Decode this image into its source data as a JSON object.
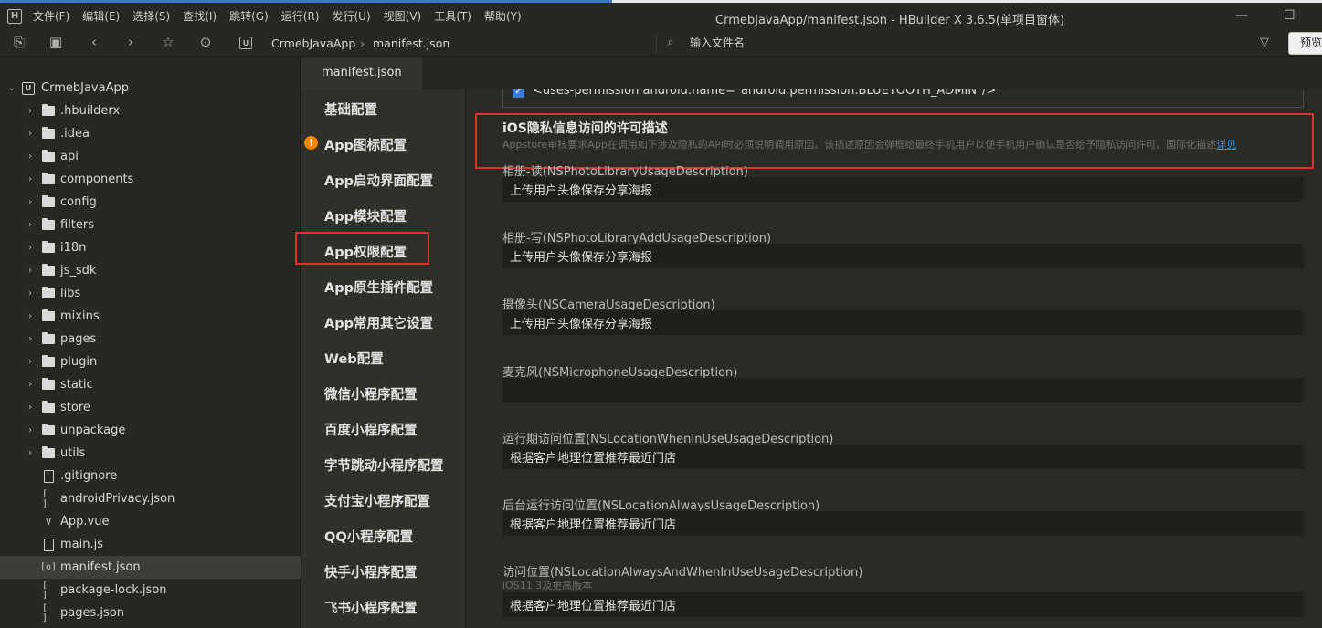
{
  "menu": {
    "logo": "H",
    "items": [
      "文件(F)",
      "编辑(E)",
      "选择(S)",
      "查找(I)",
      "跳转(G)",
      "运行(R)",
      "发行(U)",
      "视图(V)",
      "工具(T)",
      "帮助(Y)"
    ],
    "window_title": "CrmebJavaApp/manifest.json - HBuilder X 3.6.5(单项目窗体)"
  },
  "toolbar": {
    "breadcrumb_icon": "U",
    "breadcrumb": [
      "CrmebJavaApp",
      "manifest.json"
    ],
    "search_placeholder": "输入文件名",
    "preview_label": "预览"
  },
  "sidebar": {
    "root": "CrmebJavaApp",
    "root_icon": "U",
    "items": [
      {
        "label": ".hbuilderx",
        "type": "folder"
      },
      {
        "label": ".idea",
        "type": "folder"
      },
      {
        "label": "api",
        "type": "folder"
      },
      {
        "label": "components",
        "type": "folder"
      },
      {
        "label": "config",
        "type": "folder"
      },
      {
        "label": "filters",
        "type": "folder"
      },
      {
        "label": "i18n",
        "type": "folder"
      },
      {
        "label": "js_sdk",
        "type": "folder"
      },
      {
        "label": "libs",
        "type": "folder"
      },
      {
        "label": "mixins",
        "type": "folder"
      },
      {
        "label": "pages",
        "type": "folder"
      },
      {
        "label": "plugin",
        "type": "folder"
      },
      {
        "label": "static",
        "type": "folder"
      },
      {
        "label": "store",
        "type": "folder"
      },
      {
        "label": "unpackage",
        "type": "folder"
      },
      {
        "label": "utils",
        "type": "folder"
      },
      {
        "label": ".gitignore",
        "type": "file",
        "glyph": ""
      },
      {
        "label": "androidPrivacy.json",
        "type": "json",
        "glyph": "[ ]"
      },
      {
        "label": "App.vue",
        "type": "vue",
        "glyph": "V"
      },
      {
        "label": "main.js",
        "type": "js",
        "glyph": ""
      },
      {
        "label": "manifest.json",
        "type": "json",
        "glyph": "[o]",
        "selected": true
      },
      {
        "label": "package-lock.json",
        "type": "json",
        "glyph": "[ ]"
      },
      {
        "label": "pages.json",
        "type": "json",
        "glyph": "[ ]"
      }
    ]
  },
  "editor": {
    "tab": "manifest.json",
    "nav": [
      "基础配置",
      "App图标配置",
      "App启动界面配置",
      "App模块配置",
      "App权限配置",
      "App原生插件配置",
      "App常用其它设置",
      "Web配置",
      "微信小程序配置",
      "百度小程序配置",
      "字节跳动小程序配置",
      "支付宝小程序配置",
      "QQ小程序配置",
      "快手小程序配置",
      "飞书小程序配置"
    ],
    "warn_glyph": "!"
  },
  "content": {
    "permission_line": "<uses-permission android:name=\"android.permission.BLUETOOTH_ADMIN\"/>",
    "section_title": "iOS隐私信息访问的许可描述",
    "section_desc": "Appstore审核要求App在调用如下涉及隐私的API时必须说明调用原因。该描述原因会弹框给最终手机用户以便手机用户确认是否给予隐私访问许可。国际化描述",
    "section_link": "详见",
    "fields": [
      {
        "label": "相册-读(NSPhotoLibraryUsageDescription)",
        "value": "上传用户头像保存分享海报",
        "sub": ""
      },
      {
        "label": "相册-写(NSPhotoLibraryAddUsageDescription)",
        "value": "上传用户头像保存分享海报",
        "sub": ""
      },
      {
        "label": "摄像头(NSCameraUsageDescription)",
        "value": "上传用户头像保存分享海报",
        "sub": ""
      },
      {
        "label": "麦克风(NSMicrophoneUsageDescription)",
        "value": "",
        "sub": ""
      },
      {
        "label": "运行期访问位置(NSLocationWhenInUseUsageDescription)",
        "value": "根据客户地理位置推荐最近门店",
        "sub": ""
      },
      {
        "label": "后台运行访问位置(NSLocationAlwaysUsageDescription)",
        "value": "根据客户地理位置推荐最近门店",
        "sub": ""
      },
      {
        "label": "访问位置(NSLocationAlwaysAndWhenInUseUsageDescription)",
        "value": "根据客户地理位置推荐最近门店",
        "sub": "iOS11.3及更高版本"
      }
    ]
  },
  "colors": {
    "highlight": "#e23030",
    "link": "#3f92e6",
    "checkbox": "#3a7cd5",
    "warn": "#f28500"
  }
}
